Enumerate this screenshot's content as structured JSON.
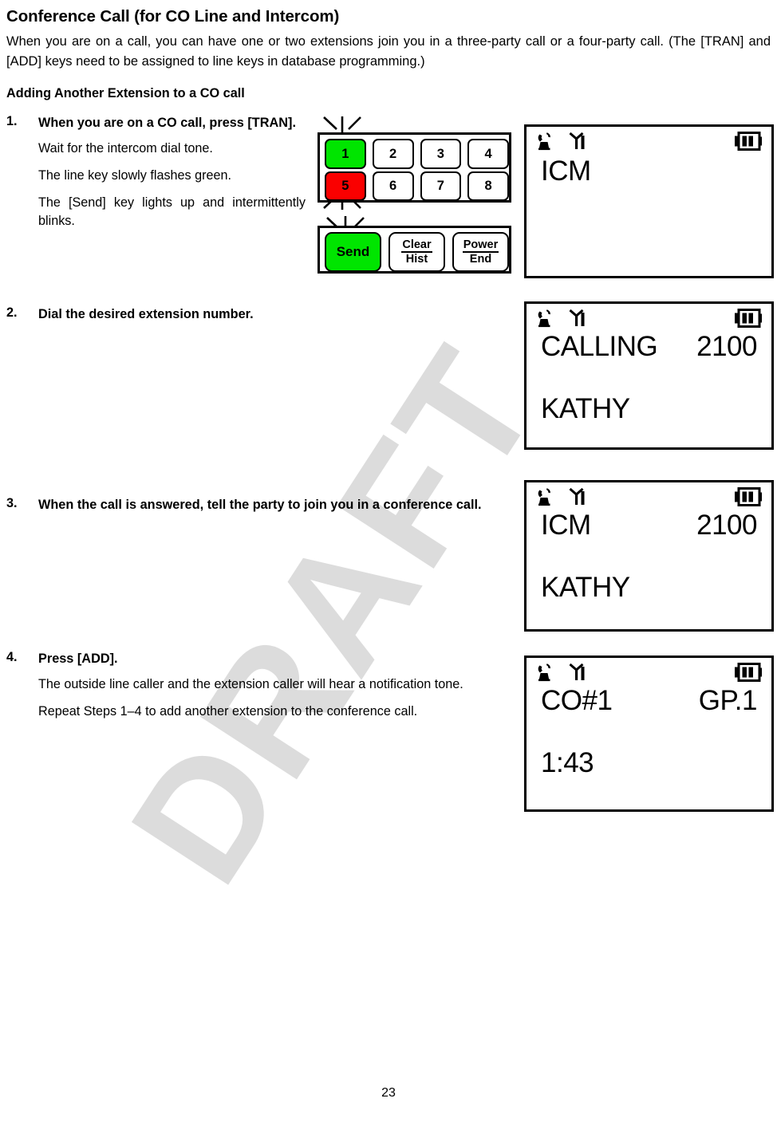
{
  "document": {
    "title": "Conference Call (for CO Line and Intercom)",
    "intro": "When you are on a call, you can have one or two extensions join you in a three-party call or a  four-party call. (The [TRAN] and [ADD] keys need to be assigned to line keys in database programming.)",
    "subheading": "Adding Another Extension to a CO call",
    "page_number": "23",
    "watermark": "DRAFT"
  },
  "steps": [
    {
      "number": "1.",
      "lead": "When you are on a CO call, press [TRAN].",
      "notes": [
        "Wait for the intercom dial tone.",
        "The line key slowly flashes green.",
        "The [Send] key lights up and intermittently blinks."
      ]
    },
    {
      "number": "2.",
      "lead": "Dial the desired extension number.",
      "notes": []
    },
    {
      "number": "3.",
      "lead": "When the call is answered, tell the party to join you in a conference call.",
      "notes": []
    },
    {
      "number": "4.",
      "lead": "Press [ADD].",
      "notes": [
        "The outside line caller and the extension caller will hear a notification tone.",
        "Repeat Steps 1–4 to add another extension to the conference call."
      ]
    }
  ],
  "keypad": {
    "colors": {
      "green": "#00e500",
      "red": "#fa0000",
      "outline": "#000000"
    },
    "line_keys": [
      {
        "label": "1",
        "state": "green",
        "flashing": true
      },
      {
        "label": "2",
        "state": "off",
        "flashing": false
      },
      {
        "label": "3",
        "state": "off",
        "flashing": false
      },
      {
        "label": "4",
        "state": "off",
        "flashing": false
      },
      {
        "label": "5",
        "state": "red",
        "flashing": true
      },
      {
        "label": "6",
        "state": "off",
        "flashing": false
      },
      {
        "label": "7",
        "state": "off",
        "flashing": false
      },
      {
        "label": "8",
        "state": "off",
        "flashing": false
      }
    ],
    "function_keys": [
      {
        "label_top": "Send",
        "label_bottom": "",
        "state": "green",
        "flashing": true
      },
      {
        "label_top": "Clear",
        "label_bottom": "Hist",
        "state": "off",
        "flashing": false
      },
      {
        "label_top": "Power",
        "label_bottom": "End",
        "state": "off",
        "flashing": false
      }
    ]
  },
  "lcd_panels": [
    {
      "id": "lcd-panel-1",
      "status_icons": [
        "handset-offhook-icon",
        "signal-antenna-icon",
        "battery-icon"
      ],
      "row1_left": "ICM",
      "row1_right": "",
      "row2_left": "",
      "row2_right": ""
    },
    {
      "id": "lcd-panel-2",
      "status_icons": [
        "handset-offhook-icon",
        "signal-antenna-icon",
        "battery-icon"
      ],
      "row1_left": "CALLING",
      "row1_right": "2100",
      "row2_left": "KATHY",
      "row2_right": ""
    },
    {
      "id": "lcd-panel-3",
      "status_icons": [
        "handset-offhook-icon",
        "signal-antenna-icon",
        "battery-icon"
      ],
      "row1_left": "ICM",
      "row1_right": "2100",
      "row2_left": "KATHY",
      "row2_right": ""
    },
    {
      "id": "lcd-panel-4",
      "status_icons": [
        "handset-offhook-icon",
        "signal-antenna-icon",
        "battery-icon"
      ],
      "row1_left": "CO#1",
      "row1_right": "GP.1",
      "row2_left": "1:43",
      "row2_right": ""
    }
  ]
}
